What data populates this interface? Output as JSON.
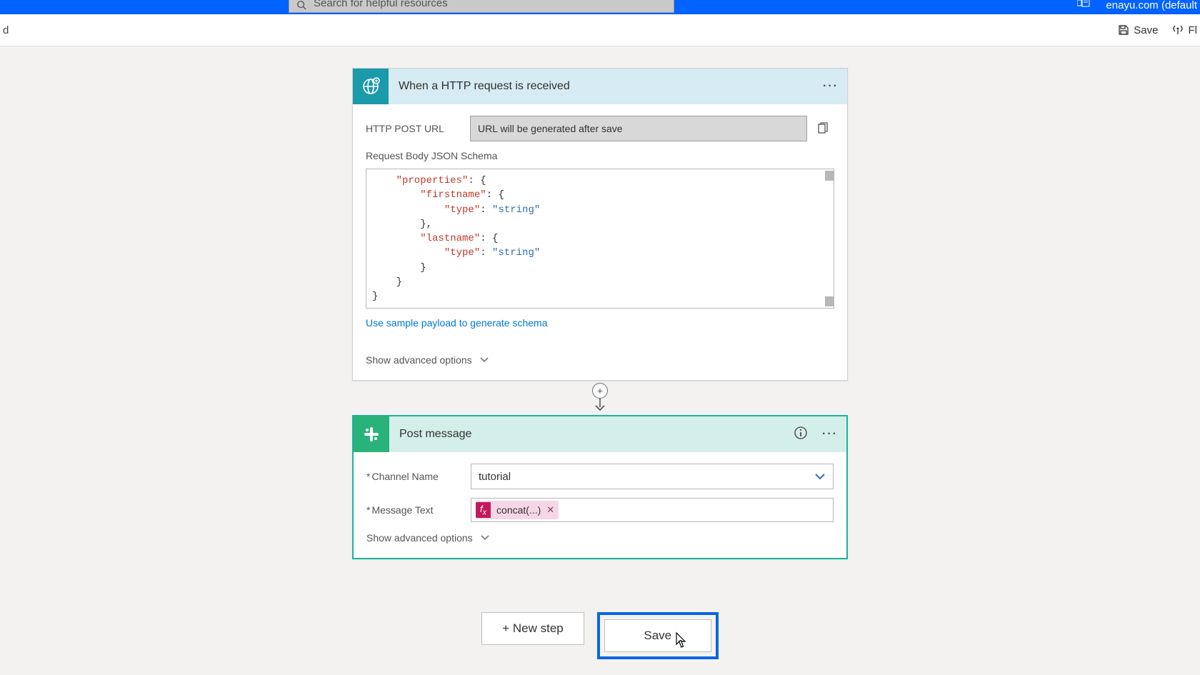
{
  "header": {
    "search_placeholder": "Search for helpful resources",
    "account_label": "enayu.com (default"
  },
  "toolbar": {
    "left_crumb": "d",
    "save_label": "Save",
    "flow_label": "Fl"
  },
  "trigger": {
    "title": "When a HTTP request is received",
    "url_label": "HTTP POST URL",
    "url_value": "URL will be generated after save",
    "schema_label": "Request Body JSON Schema",
    "sample_link": "Use sample payload to generate schema",
    "advanced": "Show advanced options"
  },
  "schema_code": {
    "l1a": "    \"properties\"",
    "l1b": ": {",
    "l2a": "        \"firstname\"",
    "l2b": ": {",
    "l3a": "            \"type\"",
    "l3b": ": ",
    "l3c": "\"string\"",
    "l4": "        },",
    "l5a": "        \"lastname\"",
    "l5b": ": {",
    "l6a": "            \"type\"",
    "l6b": ": ",
    "l6c": "\"string\"",
    "l7": "        }",
    "l8": "    }",
    "l9": "}"
  },
  "action": {
    "title": "Post message",
    "channel_label": "Channel Name",
    "channel_value": "tutorial",
    "message_label": "Message Text",
    "token_text": "concat(...)",
    "advanced": "Show advanced options"
  },
  "buttons": {
    "new_step": "+ New step",
    "save": "Save"
  }
}
